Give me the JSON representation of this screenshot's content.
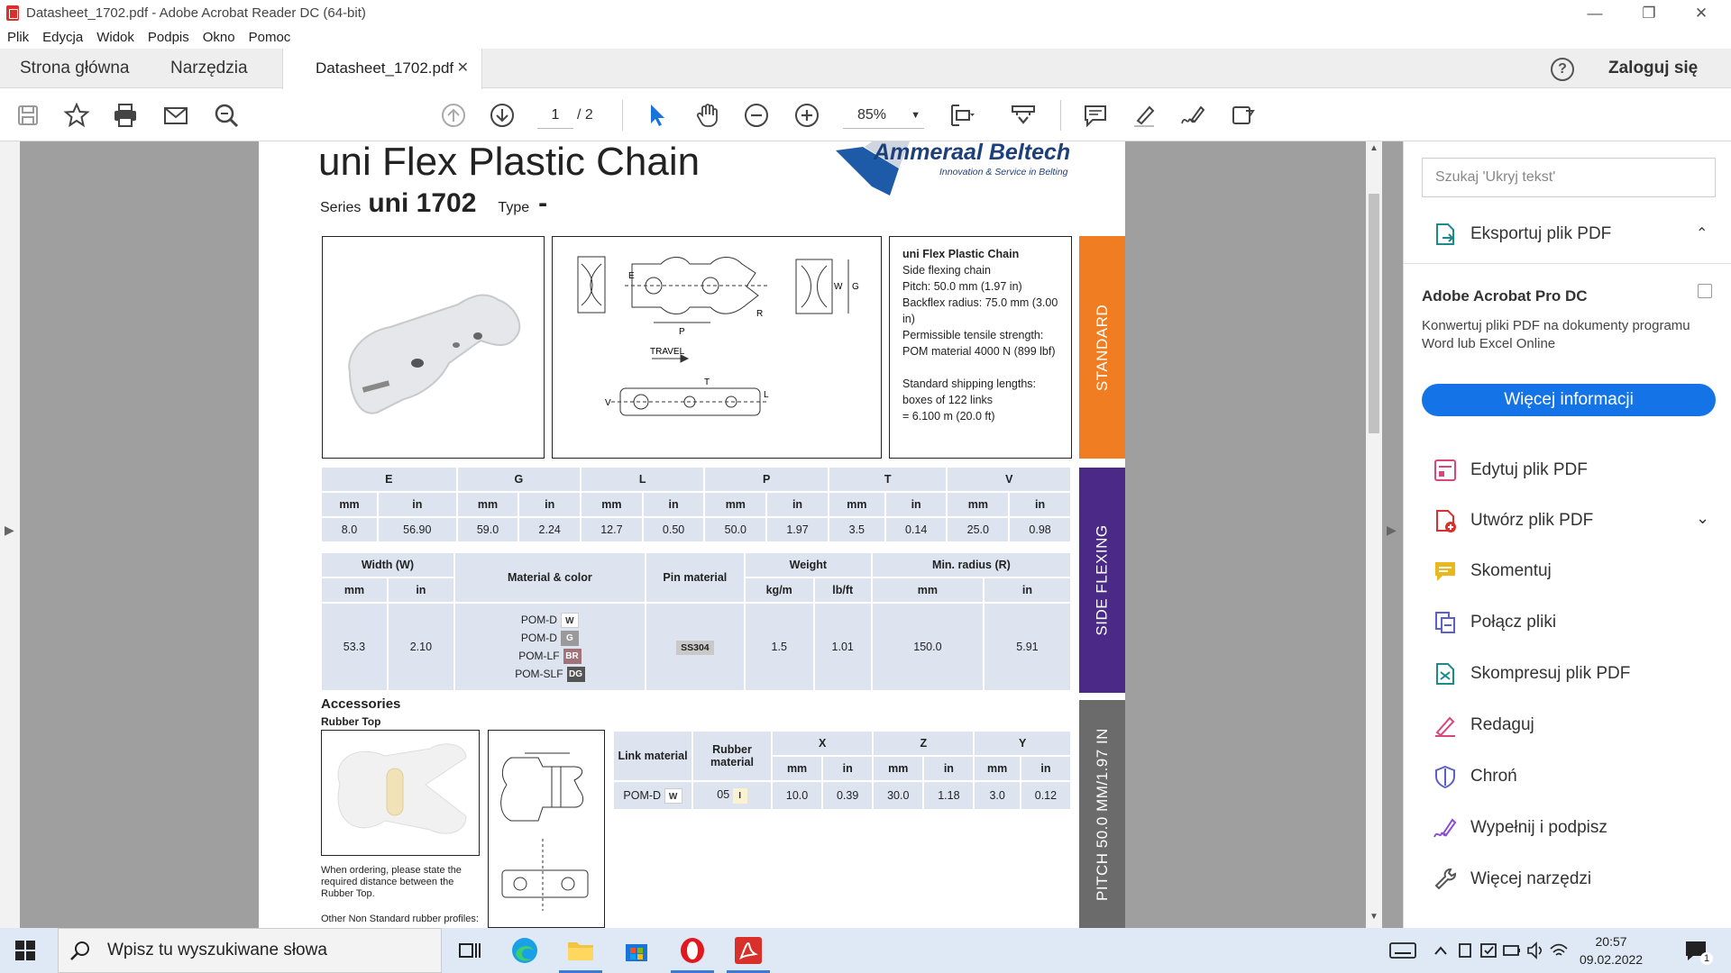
{
  "window": {
    "title": "Datasheet_1702.pdf - Adobe Acrobat Reader DC (64-bit)"
  },
  "menu": [
    "Plik",
    "Edycja",
    "Widok",
    "Podpis",
    "Okno",
    "Pomoc"
  ],
  "tabs": {
    "home": "Strona główna",
    "tools": "Narzędzia",
    "document": "Datasheet_1702.pdf",
    "login": "Zaloguj się"
  },
  "toolbar": {
    "page_current": "1",
    "page_total": "/ 2",
    "zoom": "85%"
  },
  "document": {
    "title": "uni Flex Plastic Chain",
    "series_label": "Series",
    "series_value": "uni 1702",
    "type_label": "Type",
    "type_value": "-",
    "logo": {
      "name": "Ammeraal Beltech",
      "tagline": "Innovation & Service in Belting"
    },
    "drawing": {
      "travel": "TRAVEL",
      "labels": [
        "E",
        "P",
        "R",
        "W",
        "G",
        "T",
        "V",
        "L"
      ]
    },
    "info": {
      "heading": "uni Flex Plastic Chain",
      "lines": [
        "Side flexing chain",
        "Pitch: 50.0 mm (1.97 in)",
        "Backflex radius: 75.0 mm (3.00 in)",
        "Permissible tensile strength:",
        "POM material 4000 N (899 lbf)",
        "",
        "Standard shipping lengths:",
        "boxes of 122 links",
        "= 6.100 m (20.0 ft)"
      ]
    },
    "side_tabs": {
      "standard": "STANDARD",
      "side_flexing": "SIDE FLEXING",
      "pitch": "PITCH 50.0 MM/1.97 IN"
    },
    "dims": {
      "groups": [
        "E",
        "G",
        "L",
        "P",
        "T",
        "V"
      ],
      "units": [
        "mm",
        "in",
        "mm",
        "in",
        "mm",
        "in",
        "mm",
        "in",
        "mm",
        "in",
        "mm",
        "in"
      ],
      "values": [
        "8.0",
        "56.90",
        "59.0",
        "2.24",
        "12.7",
        "0.50",
        "50.0",
        "1.97",
        "3.5",
        "0.14",
        "25.0",
        "0.98"
      ]
    },
    "spec": {
      "h_width": "Width (W)",
      "h_material": "Material & color",
      "h_pin": "Pin material",
      "h_weight": "Weight",
      "h_radius": "Min. radius (R)",
      "u_w_mm": "mm",
      "u_w_in": "in",
      "u_kg": "kg/m",
      "u_lb": "lb/ft",
      "u_r_mm": "mm",
      "u_r_in": "in",
      "width_mm": "53.3",
      "width_in": "2.10",
      "materials": [
        {
          "name": "POM-D",
          "code": "W",
          "color": "#ffffff"
        },
        {
          "name": "POM-D",
          "code": "G",
          "color": "#9a9a9a"
        },
        {
          "name": "POM-LF",
          "code": "BR",
          "color": "#a0727a"
        },
        {
          "name": "POM-SLF",
          "code": "DG",
          "color": "#555555"
        }
      ],
      "pin": "SS304",
      "kg_m": "1.5",
      "lb_ft": "1.01",
      "r_mm": "150.0",
      "r_in": "5.91"
    },
    "accessories": {
      "heading": "Accessories",
      "sub": "Rubber Top",
      "note": "When ordering, please state the required distance between the Rubber Top.",
      "other": "Other Non Standard rubber profiles:",
      "h_link": "Link material",
      "h_rubber": "Rubber material",
      "h_x": "X",
      "h_z": "Z",
      "h_y": "Y",
      "units": [
        "mm",
        "in",
        "mm",
        "in",
        "mm",
        "in"
      ],
      "link": "POM-D",
      "link_code": "W",
      "rubber": "05",
      "rubber_code": "I",
      "values": [
        "10.0",
        "0.39",
        "30.0",
        "1.18",
        "3.0",
        "0.12"
      ]
    }
  },
  "right_panel": {
    "search_placeholder": "Szukaj 'Ukryj tekst'",
    "export": "Eksportuj plik PDF",
    "promo_title": "Adobe Acrobat Pro DC",
    "promo_text": "Konwertuj pliki PDF na dokumenty programu Word lub Excel Online",
    "promo_button": "Więcej informacji",
    "tools": [
      "Edytuj plik PDF",
      "Utwórz plik PDF",
      "Skomentuj",
      "Połącz pliki",
      "Skompresuj plik PDF",
      "Redaguj",
      "Chroń",
      "Wypełnij i podpisz",
      "Więcej narzędzi"
    ]
  },
  "taskbar": {
    "search_placeholder": "Wpisz tu wyszukiwane słowa",
    "time": "20:57",
    "date": "09.02.2022",
    "notifications": "1"
  }
}
